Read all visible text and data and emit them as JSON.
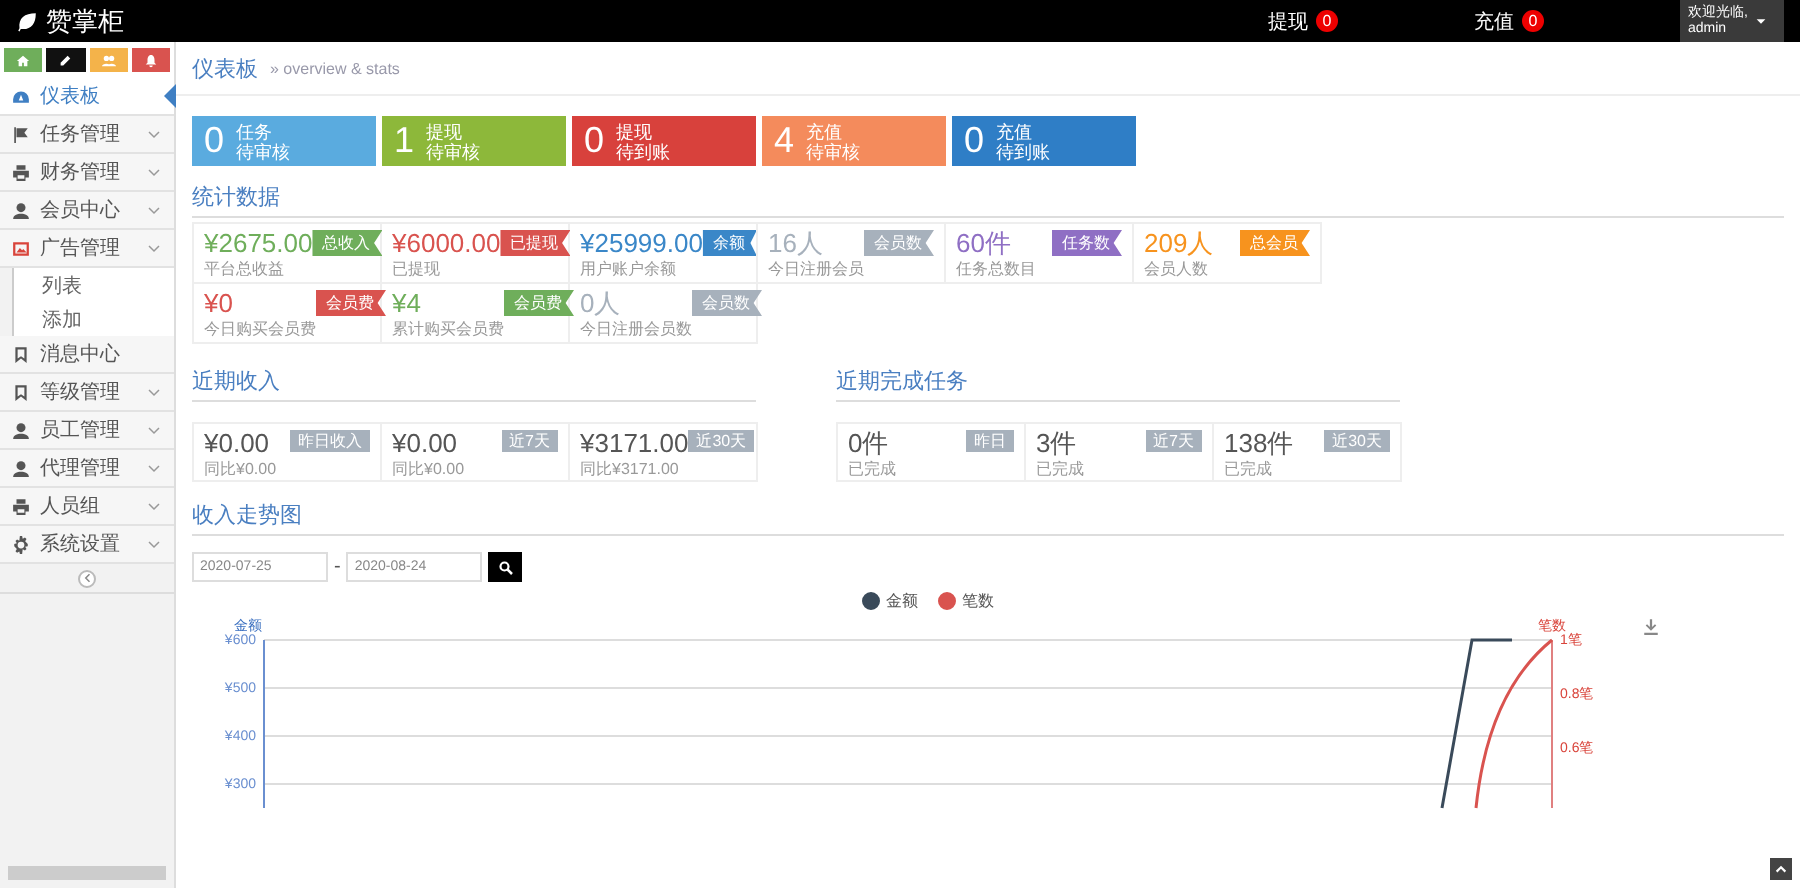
{
  "topbar": {
    "logo": "赞掌柜",
    "alerts": [
      {
        "label": "提现",
        "count": "0"
      },
      {
        "label": "充值",
        "count": "0"
      }
    ],
    "user": {
      "greeting": "欢迎光临,",
      "name": "admin"
    }
  },
  "sidebar": {
    "quick_buttons": [
      {
        "color": "#6fae5b"
      },
      {
        "color": "#111111"
      },
      {
        "color": "#f4b34a"
      },
      {
        "color": "#d9534f"
      }
    ],
    "items": [
      {
        "label": "仪表板",
        "kind": "link",
        "selected": true,
        "expanded": false
      },
      {
        "label": "任务管理",
        "kind": "group",
        "selected": false,
        "expanded": false
      },
      {
        "label": "财务管理",
        "kind": "group",
        "selected": false,
        "expanded": false
      },
      {
        "label": "会员中心",
        "kind": "group",
        "selected": false,
        "expanded": false
      },
      {
        "label": "广告管理",
        "kind": "group",
        "selected": false,
        "expanded": true,
        "children": [
          {
            "label": "列表"
          },
          {
            "label": "添加"
          }
        ]
      },
      {
        "label": "消息中心",
        "kind": "link",
        "selected": false,
        "expanded": false
      },
      {
        "label": "等级管理",
        "kind": "group",
        "selected": false,
        "expanded": false
      },
      {
        "label": "员工管理",
        "kind": "group",
        "selected": false,
        "expanded": false
      },
      {
        "label": "代理管理",
        "kind": "group",
        "selected": false,
        "expanded": false
      },
      {
        "label": "人员组",
        "kind": "group",
        "selected": false,
        "expanded": false
      },
      {
        "label": "系统设置",
        "kind": "group",
        "selected": false,
        "expanded": false
      }
    ]
  },
  "breadcrumb": {
    "title": "仪表板",
    "subtitle": "» overview & stats"
  },
  "tiles": [
    {
      "value": "0",
      "line1": "任务",
      "line2": "待审核",
      "color": "#5aabdf"
    },
    {
      "value": "1",
      "line1": "提现",
      "line2": "待审核",
      "color": "#8db83a"
    },
    {
      "value": "0",
      "line1": "提现",
      "line2": "待到账",
      "color": "#d8413c"
    },
    {
      "value": "4",
      "line1": "充值",
      "line2": "待审核",
      "color": "#f48b5c"
    },
    {
      "value": "0",
      "line1": "充值",
      "line2": "待到账",
      "color": "#2f7ec6"
    }
  ],
  "stats": {
    "title": "统计数据",
    "rows": [
      [
        {
          "value": "¥2675.00",
          "label": "平台总收益",
          "tag": "总收入",
          "color": "#6fae5b"
        },
        {
          "value": "¥6000.00",
          "label": "已提现",
          "tag": "已提现",
          "color": "#d9534f"
        },
        {
          "value": "¥25999.00",
          "label": "用户账户余额",
          "tag": "余额",
          "color": "#3a87c8"
        },
        {
          "value": "16人",
          "label": "今日注册会员",
          "tag": "会员数",
          "color": "#a7b1bc"
        },
        {
          "value": "60件",
          "label": "任务总数目",
          "tag": "任务数",
          "color": "#8f6fc4"
        },
        {
          "value": "209人",
          "label": "会员人数",
          "tag": "总会员",
          "color": "#f7931e"
        }
      ],
      [
        {
          "value": "¥0",
          "label": "今日购买会员费",
          "tag": "会员费",
          "color": "#d9534f"
        },
        {
          "value": "¥4",
          "label": "累计购买会员费",
          "tag": "会员费",
          "color": "#6fae5b"
        },
        {
          "value": "0人",
          "label": "今日注册会员数",
          "tag": "会员数",
          "color": "#a7b1bc"
        }
      ]
    ]
  },
  "income": {
    "title": "近期收入",
    "cards": [
      {
        "value": "¥0.00",
        "label": "同比¥0.00",
        "tag": "昨日收入"
      },
      {
        "value": "¥0.00",
        "label": "同比¥0.00",
        "tag": "近7天"
      },
      {
        "value": "¥3171.00",
        "label": "同比¥3171.00",
        "tag": "近30天"
      }
    ]
  },
  "tasks": {
    "title": "近期完成任务",
    "cards": [
      {
        "value": "0件",
        "label": "已完成",
        "tag": "昨日"
      },
      {
        "value": "3件",
        "label": "已完成",
        "tag": "近7天"
      },
      {
        "value": "138件",
        "label": "已完成",
        "tag": "近30天"
      }
    ]
  },
  "chart": {
    "title": "收入走势图",
    "start_date": "2020-07-25",
    "separator": "-",
    "end_date": "2020-08-24",
    "legend": [
      {
        "name": "金额",
        "color": "#3a4a5a"
      },
      {
        "name": "笔数",
        "color": "#d9534f"
      }
    ],
    "left_axis": {
      "label": "金额",
      "ticks": [
        "¥600",
        "¥500",
        "¥400",
        "¥300"
      ]
    },
    "right_axis": {
      "label": "笔数",
      "ticks": [
        "1笔",
        "0.8笔",
        "0.6笔"
      ]
    }
  }
}
